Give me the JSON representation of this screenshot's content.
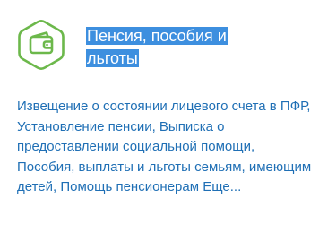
{
  "card": {
    "icon": "wallet-icon",
    "accent_color": "#6cb84b",
    "title": "Пенсия, пособия и льготы",
    "title_highlight_color": "#3d8fdf",
    "description": "Извещение о состоянии лицевого счета в ПФР, Установление пенсии, Выписка о предоставлении социальной помощи, Пособия, выплаты и льготы семьям, имеющим детей, Помощь пенсионерам",
    "more_label": "Еще...",
    "text_color": "#1f6fb5"
  }
}
